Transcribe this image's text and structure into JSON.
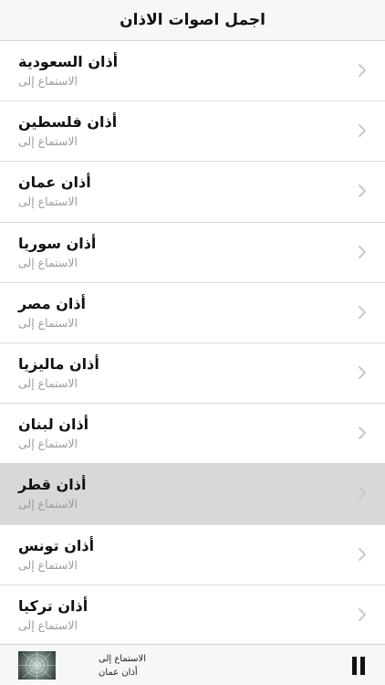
{
  "header": {
    "title": "اجمل اصوات الاذان"
  },
  "list": {
    "items": [
      {
        "title": "أذان السعودية",
        "subtitle": "الاستماع إلى",
        "selected": false
      },
      {
        "title": "أذان فلسطين",
        "subtitle": "الاستماع إلى",
        "selected": false
      },
      {
        "title": "أذان عمان",
        "subtitle": "الاستماع إلى",
        "selected": false
      },
      {
        "title": "أذان سوريا",
        "subtitle": "الاستماع إلى",
        "selected": false
      },
      {
        "title": "أذان مصر",
        "subtitle": "الاستماع إلى",
        "selected": false
      },
      {
        "title": "أذان ماليزيا",
        "subtitle": "الاستماع إلى",
        "selected": false
      },
      {
        "title": "أذان لبنان",
        "subtitle": "الاستماع إلى",
        "selected": false
      },
      {
        "title": "أذان قطر",
        "subtitle": "الاستماع إلى",
        "selected": true
      },
      {
        "title": "أذان تونس",
        "subtitle": "الاستماع إلى",
        "selected": false
      },
      {
        "title": "أذان تركيا",
        "subtitle": "الاستماع إلى",
        "selected": false
      }
    ],
    "row_icon": "chevron-right-icon"
  },
  "player": {
    "status": "الاستماع إلى",
    "track": "أذان عمان",
    "control_icon": "pause-icon",
    "artwork_icon": "album-artwork"
  },
  "colors": {
    "selected_row": "#d8d8d8",
    "subtitle": "#9b9b9b",
    "chevron": "#c7c7cc"
  }
}
